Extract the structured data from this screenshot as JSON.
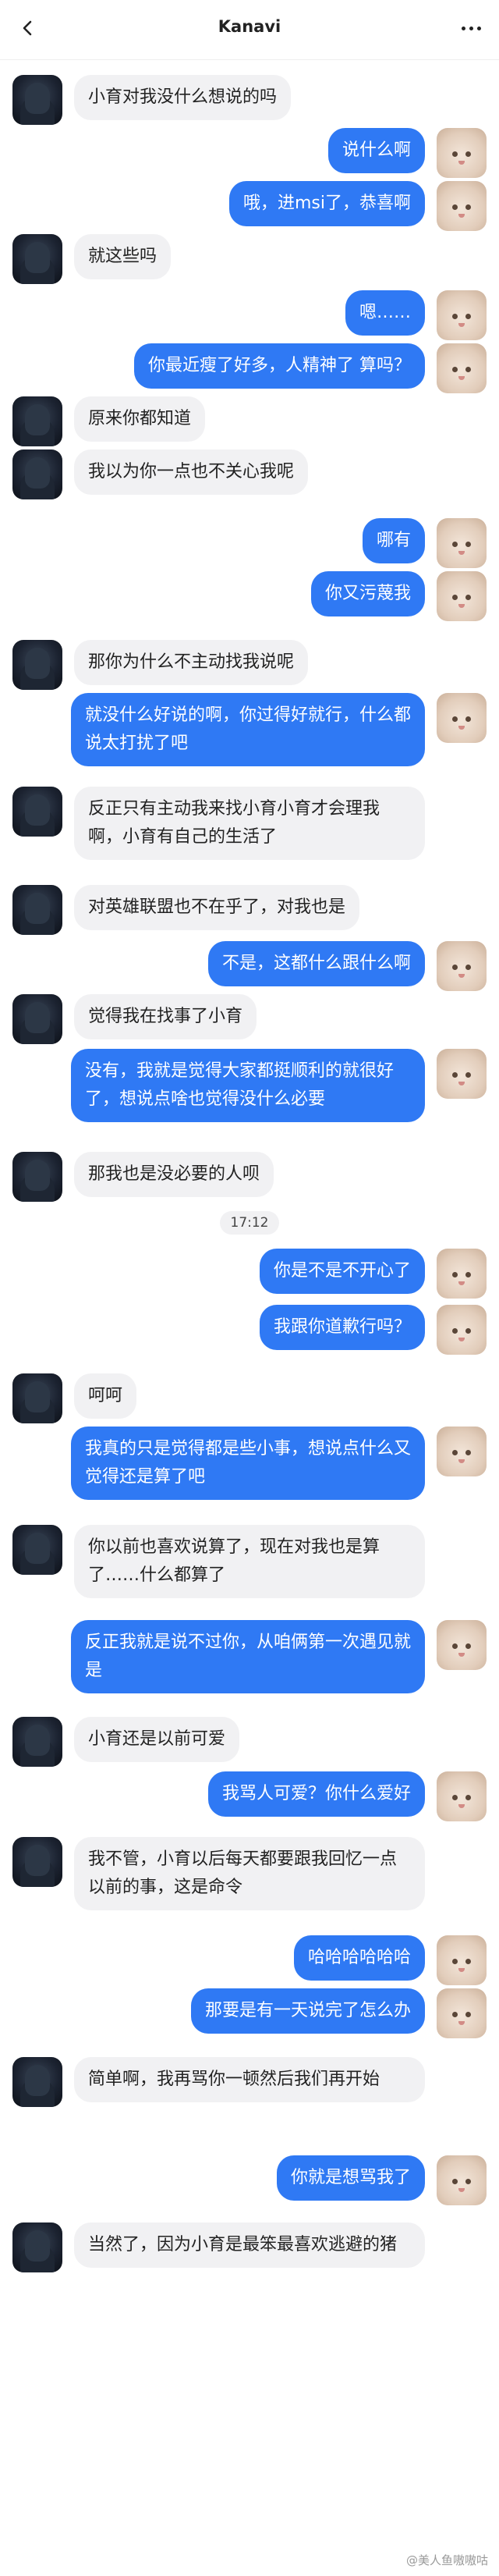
{
  "header": {
    "title": "Kanavi"
  },
  "messages": [
    {
      "side": "left",
      "text": "小育对我没什么想说的吗"
    },
    {
      "side": "right",
      "text": "说什么啊"
    },
    {
      "side": "right",
      "text": "哦，进msi了，恭喜啊"
    },
    {
      "side": "left",
      "text": "就这些吗"
    },
    {
      "side": "right",
      "text": "嗯……"
    },
    {
      "side": "right",
      "text": "你最近瘦了好多，人精神了 算吗？"
    },
    {
      "side": "left",
      "text": "原来你都知道"
    },
    {
      "side": "left",
      "text": "我以为你一点也不关心我呢"
    },
    {
      "side": "right",
      "text": "哪有"
    },
    {
      "side": "right",
      "text": "你又污蔑我"
    },
    {
      "side": "left",
      "text": "那你为什么不主动找我说呢"
    },
    {
      "side": "right",
      "text": "就没什么好说的啊，你过得好就行，什么都说太打扰了吧"
    },
    {
      "side": "left",
      "text": "反正只有主动我来找小育小育才会理我啊，小育有自己的生活了"
    },
    {
      "side": "left",
      "text": "对英雄联盟也不在乎了，对我也是"
    },
    {
      "side": "right",
      "text": "不是，这都什么跟什么啊"
    },
    {
      "side": "left",
      "text": "觉得我在找事了小育"
    },
    {
      "side": "right",
      "text": "没有，我就是觉得大家都挺顺利的就很好了，想说点啥也觉得没什么必要"
    },
    {
      "side": "left",
      "text": "那我也是没必要的人呗"
    },
    {
      "side": "right",
      "text": "你是不是不开心了"
    },
    {
      "side": "right",
      "text": "我跟你道歉行吗？"
    },
    {
      "side": "left",
      "text": "呵呵"
    },
    {
      "side": "right",
      "text": "我真的只是觉得都是些小事，想说点什么又觉得还是算了吧"
    },
    {
      "side": "left",
      "text": "你以前也喜欢说算了，现在对我也是算了……什么都算了"
    },
    {
      "side": "right",
      "text": "反正我就是说不过你，从咱俩第一次遇见就是"
    },
    {
      "side": "left",
      "text": "小育还是以前可爱"
    },
    {
      "side": "right",
      "text": "我骂人可爱？你什么爱好"
    },
    {
      "side": "left",
      "text": "我不管，小育以后每天都要跟我回忆一点以前的事，这是命令"
    },
    {
      "side": "right",
      "text": "哈哈哈哈哈哈"
    },
    {
      "side": "right",
      "text": "那要是有一天说完了怎么办"
    },
    {
      "side": "left",
      "text": "简单啊，我再骂你一顿然后我们再开始"
    },
    {
      "side": "right",
      "text": "你就是想骂我了"
    },
    {
      "side": "left",
      "text": "当然了，因为小育是最笨最喜欢逃避的猪"
    }
  ],
  "timestamp": "17:12",
  "watermark": "@美人鱼嗷嗷咕",
  "colors": {
    "sent_bubble": "#2f79f4",
    "received_bubble": "#f1f1f3"
  },
  "icons": {
    "back": "back-arrow-icon",
    "more": "more-dots-icon"
  }
}
